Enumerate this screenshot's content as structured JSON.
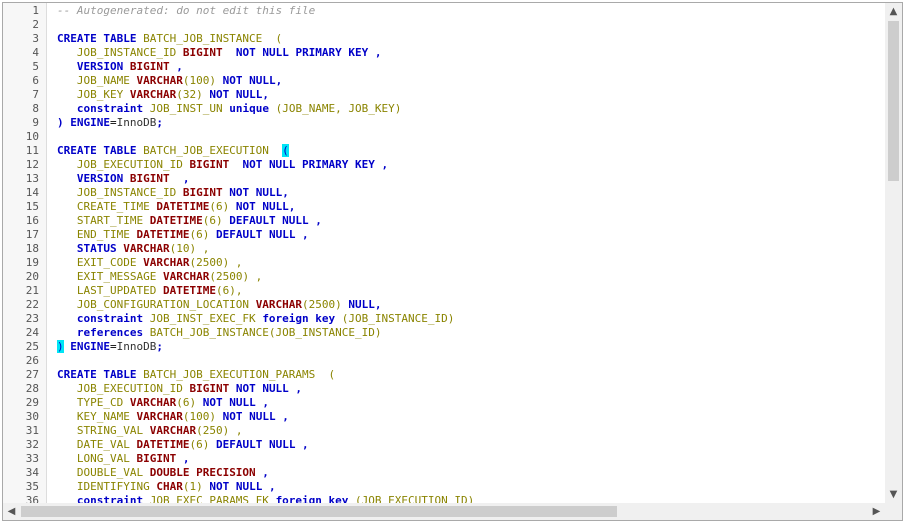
{
  "editor": {
    "lines": [
      [
        {
          "t": "-- Autogenerated: do not edit this file",
          "c": "comment"
        }
      ],
      [],
      [
        {
          "t": "CREATE TABLE ",
          "c": "keyword"
        },
        {
          "t": "BATCH_JOB_INSTANCE  (",
          "c": "ident"
        }
      ],
      [
        {
          "t": "   JOB_INSTANCE_ID ",
          "c": "ident"
        },
        {
          "t": "BIGINT",
          "c": "type"
        },
        {
          "t": "  NOT NULL PRIMARY KEY ,",
          "c": "keyword"
        }
      ],
      [
        {
          "t": "   VERSION ",
          "c": "keyword"
        },
        {
          "t": "BIGINT",
          "c": "type"
        },
        {
          "t": " ,",
          "c": "keyword"
        }
      ],
      [
        {
          "t": "   JOB_NAME ",
          "c": "ident"
        },
        {
          "t": "VARCHAR",
          "c": "type"
        },
        {
          "t": "(100) ",
          "c": "ident"
        },
        {
          "t": "NOT NULL,",
          "c": "keyword"
        }
      ],
      [
        {
          "t": "   JOB_KEY ",
          "c": "ident"
        },
        {
          "t": "VARCHAR",
          "c": "type"
        },
        {
          "t": "(32) ",
          "c": "ident"
        },
        {
          "t": "NOT NULL,",
          "c": "keyword"
        }
      ],
      [
        {
          "t": "   constraint ",
          "c": "keyword"
        },
        {
          "t": "JOB_INST_UN ",
          "c": "ident"
        },
        {
          "t": "unique",
          "c": "keyword"
        },
        {
          "t": " (JOB_NAME, JOB_KEY)",
          "c": "ident"
        }
      ],
      [
        {
          "t": ") ENGINE",
          "c": "keyword"
        },
        {
          "t": "=",
          "c": "operator"
        },
        {
          "t": "InnoDB",
          "c": "plain"
        },
        {
          "t": ";",
          "c": "keyword"
        }
      ],
      [],
      [
        {
          "t": "CREATE TABLE ",
          "c": "keyword"
        },
        {
          "t": "BATCH_JOB_EXECUTION  ",
          "c": "ident"
        },
        {
          "t": "(",
          "c": "bracket-match"
        }
      ],
      [
        {
          "t": "   JOB_EXECUTION_ID ",
          "c": "ident"
        },
        {
          "t": "BIGINT",
          "c": "type"
        },
        {
          "t": "  NOT NULL PRIMARY KEY ,",
          "c": "keyword"
        }
      ],
      [
        {
          "t": "   VERSION ",
          "c": "keyword"
        },
        {
          "t": "BIGINT",
          "c": "type"
        },
        {
          "t": "  ,",
          "c": "keyword"
        }
      ],
      [
        {
          "t": "   JOB_INSTANCE_ID ",
          "c": "ident"
        },
        {
          "t": "BIGINT",
          "c": "type"
        },
        {
          "t": " NOT NULL,",
          "c": "keyword"
        }
      ],
      [
        {
          "t": "   CREATE_TIME ",
          "c": "ident"
        },
        {
          "t": "DATETIME",
          "c": "type"
        },
        {
          "t": "(6) ",
          "c": "ident"
        },
        {
          "t": "NOT NULL,",
          "c": "keyword"
        }
      ],
      [
        {
          "t": "   START_TIME ",
          "c": "ident"
        },
        {
          "t": "DATETIME",
          "c": "type"
        },
        {
          "t": "(6) ",
          "c": "ident"
        },
        {
          "t": "DEFAULT NULL ,",
          "c": "keyword"
        }
      ],
      [
        {
          "t": "   END_TIME ",
          "c": "ident"
        },
        {
          "t": "DATETIME",
          "c": "type"
        },
        {
          "t": "(6) ",
          "c": "ident"
        },
        {
          "t": "DEFAULT NULL ,",
          "c": "keyword"
        }
      ],
      [
        {
          "t": "   STATUS ",
          "c": "keyword"
        },
        {
          "t": "VARCHAR",
          "c": "type"
        },
        {
          "t": "(10) ,",
          "c": "ident"
        }
      ],
      [
        {
          "t": "   EXIT_CODE ",
          "c": "ident"
        },
        {
          "t": "VARCHAR",
          "c": "type"
        },
        {
          "t": "(2500) ,",
          "c": "ident"
        }
      ],
      [
        {
          "t": "   EXIT_MESSAGE ",
          "c": "ident"
        },
        {
          "t": "VARCHAR",
          "c": "type"
        },
        {
          "t": "(2500) ,",
          "c": "ident"
        }
      ],
      [
        {
          "t": "   LAST_UPDATED ",
          "c": "ident"
        },
        {
          "t": "DATETIME",
          "c": "type"
        },
        {
          "t": "(6),",
          "c": "ident"
        }
      ],
      [
        {
          "t": "   JOB_CONFIGURATION_LOCATION ",
          "c": "ident"
        },
        {
          "t": "VARCHAR",
          "c": "type"
        },
        {
          "t": "(2500) ",
          "c": "ident"
        },
        {
          "t": "NULL,",
          "c": "keyword"
        }
      ],
      [
        {
          "t": "   constraint ",
          "c": "keyword"
        },
        {
          "t": "JOB_INST_EXEC_FK ",
          "c": "ident"
        },
        {
          "t": "foreign key",
          "c": "keyword"
        },
        {
          "t": " (JOB_INSTANCE_ID)",
          "c": "ident"
        }
      ],
      [
        {
          "t": "   references ",
          "c": "keyword"
        },
        {
          "t": "BATCH_JOB_INSTANCE(JOB_INSTANCE_ID)",
          "c": "ident"
        }
      ],
      [
        {
          "t": ")",
          "c": "bracket-match"
        },
        {
          "t": " ENGINE",
          "c": "keyword"
        },
        {
          "t": "=",
          "c": "operator"
        },
        {
          "t": "InnoDB",
          "c": "plain"
        },
        {
          "t": ";",
          "c": "keyword"
        }
      ],
      [],
      [
        {
          "t": "CREATE TABLE ",
          "c": "keyword"
        },
        {
          "t": "BATCH_JOB_EXECUTION_PARAMS  (",
          "c": "ident"
        }
      ],
      [
        {
          "t": "   JOB_EXECUTION_ID ",
          "c": "ident"
        },
        {
          "t": "BIGINT",
          "c": "type"
        },
        {
          "t": " NOT NULL ,",
          "c": "keyword"
        }
      ],
      [
        {
          "t": "   TYPE_CD ",
          "c": "ident"
        },
        {
          "t": "VARCHAR",
          "c": "type"
        },
        {
          "t": "(6) ",
          "c": "ident"
        },
        {
          "t": "NOT NULL ,",
          "c": "keyword"
        }
      ],
      [
        {
          "t": "   KEY_NAME ",
          "c": "ident"
        },
        {
          "t": "VARCHAR",
          "c": "type"
        },
        {
          "t": "(100) ",
          "c": "ident"
        },
        {
          "t": "NOT NULL ,",
          "c": "keyword"
        }
      ],
      [
        {
          "t": "   STRING_VAL ",
          "c": "ident"
        },
        {
          "t": "VARCHAR",
          "c": "type"
        },
        {
          "t": "(250) ,",
          "c": "ident"
        }
      ],
      [
        {
          "t": "   DATE_VAL ",
          "c": "ident"
        },
        {
          "t": "DATETIME",
          "c": "type"
        },
        {
          "t": "(6) ",
          "c": "ident"
        },
        {
          "t": "DEFAULT NULL ,",
          "c": "keyword"
        }
      ],
      [
        {
          "t": "   LONG_VAL ",
          "c": "ident"
        },
        {
          "t": "BIGINT",
          "c": "type"
        },
        {
          "t": " ,",
          "c": "keyword"
        }
      ],
      [
        {
          "t": "   DOUBLE_VAL ",
          "c": "ident"
        },
        {
          "t": "DOUBLE PRECISION",
          "c": "type"
        },
        {
          "t": " ,",
          "c": "keyword"
        }
      ],
      [
        {
          "t": "   IDENTIFYING ",
          "c": "ident"
        },
        {
          "t": "CHAR",
          "c": "type"
        },
        {
          "t": "(1) ",
          "c": "ident"
        },
        {
          "t": "NOT NULL ,",
          "c": "keyword"
        }
      ],
      [
        {
          "t": "   constraint ",
          "c": "keyword"
        },
        {
          "t": "JOB_EXEC_PARAMS_FK ",
          "c": "ident"
        },
        {
          "t": "foreign key",
          "c": "keyword"
        },
        {
          "t": " (JOB_EXECUTION_ID)",
          "c": "ident"
        }
      ]
    ]
  },
  "scrollbars": {
    "vertical": {
      "up_icon": "▲",
      "down_icon": "▼",
      "position_fraction": 0.0
    },
    "horizontal": {
      "left_icon": "◀",
      "right_icon": "▶",
      "position_fraction": 0.0
    }
  },
  "colors": {
    "keyword": "#0000c8",
    "type": "#8b0000",
    "identifier": "#8a8400",
    "comment": "#9a9a9a",
    "bracket_highlight": "#00e5f5"
  }
}
